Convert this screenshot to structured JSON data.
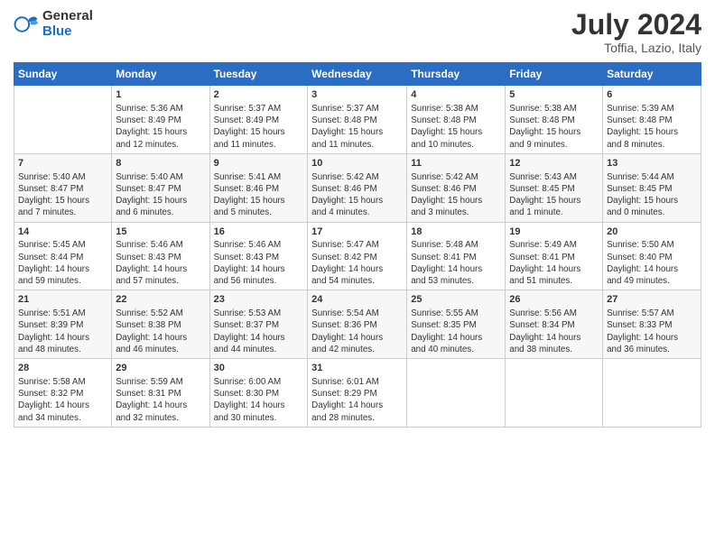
{
  "logo": {
    "general": "General",
    "blue": "Blue"
  },
  "title": "July 2024",
  "subtitle": "Toffia, Lazio, Italy",
  "days_header": [
    "Sunday",
    "Monday",
    "Tuesday",
    "Wednesday",
    "Thursday",
    "Friday",
    "Saturday"
  ],
  "weeks": [
    [
      {
        "day": "",
        "info": ""
      },
      {
        "day": "1",
        "info": "Sunrise: 5:36 AM\nSunset: 8:49 PM\nDaylight: 15 hours\nand 12 minutes."
      },
      {
        "day": "2",
        "info": "Sunrise: 5:37 AM\nSunset: 8:49 PM\nDaylight: 15 hours\nand 11 minutes."
      },
      {
        "day": "3",
        "info": "Sunrise: 5:37 AM\nSunset: 8:48 PM\nDaylight: 15 hours\nand 11 minutes."
      },
      {
        "day": "4",
        "info": "Sunrise: 5:38 AM\nSunset: 8:48 PM\nDaylight: 15 hours\nand 10 minutes."
      },
      {
        "day": "5",
        "info": "Sunrise: 5:38 AM\nSunset: 8:48 PM\nDaylight: 15 hours\nand 9 minutes."
      },
      {
        "day": "6",
        "info": "Sunrise: 5:39 AM\nSunset: 8:48 PM\nDaylight: 15 hours\nand 8 minutes."
      }
    ],
    [
      {
        "day": "7",
        "info": "Sunrise: 5:40 AM\nSunset: 8:47 PM\nDaylight: 15 hours\nand 7 minutes."
      },
      {
        "day": "8",
        "info": "Sunrise: 5:40 AM\nSunset: 8:47 PM\nDaylight: 15 hours\nand 6 minutes."
      },
      {
        "day": "9",
        "info": "Sunrise: 5:41 AM\nSunset: 8:46 PM\nDaylight: 15 hours\nand 5 minutes."
      },
      {
        "day": "10",
        "info": "Sunrise: 5:42 AM\nSunset: 8:46 PM\nDaylight: 15 hours\nand 4 minutes."
      },
      {
        "day": "11",
        "info": "Sunrise: 5:42 AM\nSunset: 8:46 PM\nDaylight: 15 hours\nand 3 minutes."
      },
      {
        "day": "12",
        "info": "Sunrise: 5:43 AM\nSunset: 8:45 PM\nDaylight: 15 hours\nand 1 minute."
      },
      {
        "day": "13",
        "info": "Sunrise: 5:44 AM\nSunset: 8:45 PM\nDaylight: 15 hours\nand 0 minutes."
      }
    ],
    [
      {
        "day": "14",
        "info": "Sunrise: 5:45 AM\nSunset: 8:44 PM\nDaylight: 14 hours\nand 59 minutes."
      },
      {
        "day": "15",
        "info": "Sunrise: 5:46 AM\nSunset: 8:43 PM\nDaylight: 14 hours\nand 57 minutes."
      },
      {
        "day": "16",
        "info": "Sunrise: 5:46 AM\nSunset: 8:43 PM\nDaylight: 14 hours\nand 56 minutes."
      },
      {
        "day": "17",
        "info": "Sunrise: 5:47 AM\nSunset: 8:42 PM\nDaylight: 14 hours\nand 54 minutes."
      },
      {
        "day": "18",
        "info": "Sunrise: 5:48 AM\nSunset: 8:41 PM\nDaylight: 14 hours\nand 53 minutes."
      },
      {
        "day": "19",
        "info": "Sunrise: 5:49 AM\nSunset: 8:41 PM\nDaylight: 14 hours\nand 51 minutes."
      },
      {
        "day": "20",
        "info": "Sunrise: 5:50 AM\nSunset: 8:40 PM\nDaylight: 14 hours\nand 49 minutes."
      }
    ],
    [
      {
        "day": "21",
        "info": "Sunrise: 5:51 AM\nSunset: 8:39 PM\nDaylight: 14 hours\nand 48 minutes."
      },
      {
        "day": "22",
        "info": "Sunrise: 5:52 AM\nSunset: 8:38 PM\nDaylight: 14 hours\nand 46 minutes."
      },
      {
        "day": "23",
        "info": "Sunrise: 5:53 AM\nSunset: 8:37 PM\nDaylight: 14 hours\nand 44 minutes."
      },
      {
        "day": "24",
        "info": "Sunrise: 5:54 AM\nSunset: 8:36 PM\nDaylight: 14 hours\nand 42 minutes."
      },
      {
        "day": "25",
        "info": "Sunrise: 5:55 AM\nSunset: 8:35 PM\nDaylight: 14 hours\nand 40 minutes."
      },
      {
        "day": "26",
        "info": "Sunrise: 5:56 AM\nSunset: 8:34 PM\nDaylight: 14 hours\nand 38 minutes."
      },
      {
        "day": "27",
        "info": "Sunrise: 5:57 AM\nSunset: 8:33 PM\nDaylight: 14 hours\nand 36 minutes."
      }
    ],
    [
      {
        "day": "28",
        "info": "Sunrise: 5:58 AM\nSunset: 8:32 PM\nDaylight: 14 hours\nand 34 minutes."
      },
      {
        "day": "29",
        "info": "Sunrise: 5:59 AM\nSunset: 8:31 PM\nDaylight: 14 hours\nand 32 minutes."
      },
      {
        "day": "30",
        "info": "Sunrise: 6:00 AM\nSunset: 8:30 PM\nDaylight: 14 hours\nand 30 minutes."
      },
      {
        "day": "31",
        "info": "Sunrise: 6:01 AM\nSunset: 8:29 PM\nDaylight: 14 hours\nand 28 minutes."
      },
      {
        "day": "",
        "info": ""
      },
      {
        "day": "",
        "info": ""
      },
      {
        "day": "",
        "info": ""
      }
    ]
  ]
}
